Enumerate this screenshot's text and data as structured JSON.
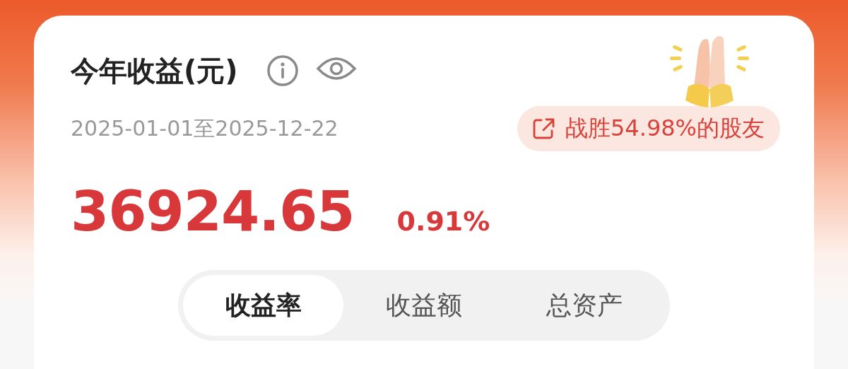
{
  "card": {
    "title": "今年收益(元)",
    "date_range": "2025-01-01至2025-12-22",
    "rank_badge": "战胜54.98%的股友",
    "amount": "36924.65",
    "rate": "0.91%"
  },
  "tabs": [
    {
      "label": "收益率",
      "selected": true
    },
    {
      "label": "收益额",
      "selected": false
    },
    {
      "label": "总资产",
      "selected": false
    }
  ]
}
